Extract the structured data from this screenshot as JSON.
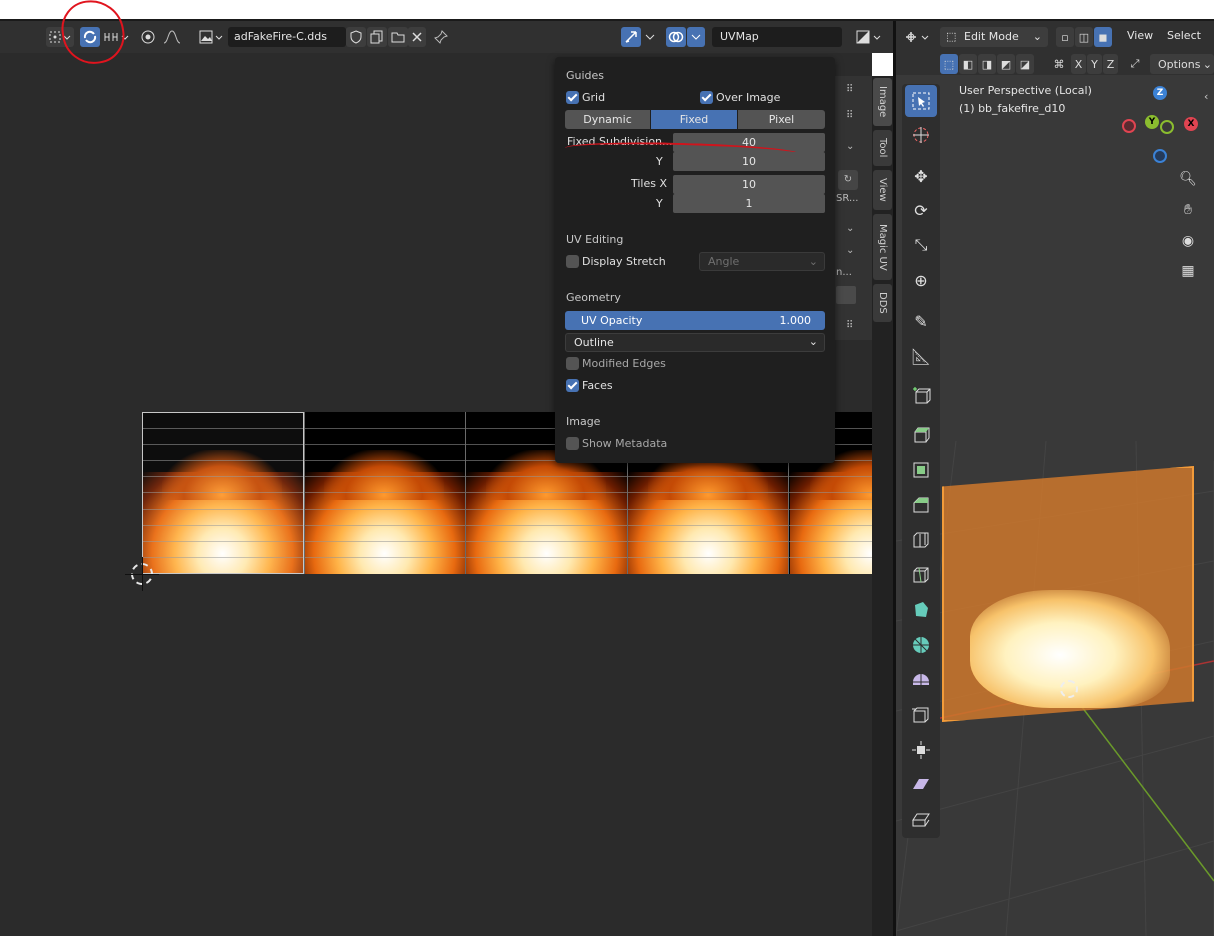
{
  "uv_editor": {
    "image_name": "adFakeFire-C.dds",
    "uv_map": "UVMap",
    "sidebar_tabs": [
      "Image",
      "Tool",
      "View",
      "Magic UV",
      "DDS"
    ],
    "panel_fragments": [
      "SR...",
      "n..."
    ]
  },
  "overlay_popover": {
    "guides_title": "Guides",
    "grid_label": "Grid",
    "grid_checked": true,
    "over_image_label": "Over Image",
    "over_image_checked": true,
    "grid_modes": [
      "Dynamic",
      "Fixed",
      "Pixel"
    ],
    "grid_mode_selected": "Fixed",
    "fixed_subdivisions_label": "Fixed Subdivision...",
    "fixed_subdivisions_x": "40",
    "y_label": "Y",
    "fixed_subdivisions_y": "10",
    "tiles_x_label": "Tiles X",
    "tiles_x": "10",
    "tiles_y_label": "Y",
    "tiles_y": "1",
    "uv_editing_title": "UV Editing",
    "display_stretch_label": "Display Stretch",
    "display_stretch_checked": false,
    "stretch_type": "Angle",
    "geometry_title": "Geometry",
    "uv_opacity_label": "UV Opacity",
    "uv_opacity_value": "1.000",
    "edge_display": "Outline",
    "modified_edges_label": "Modified Edges",
    "modified_edges_checked": false,
    "faces_label": "Faces",
    "faces_checked": true,
    "image_title": "Image",
    "show_metadata_label": "Show Metadata",
    "show_metadata_checked": false
  },
  "viewport": {
    "mode": "Edit Mode",
    "menu": [
      "View",
      "Select"
    ],
    "axis_buttons": [
      "X",
      "Y",
      "Z"
    ],
    "options_label": "Options",
    "perspective_label": "User Perspective (Local)",
    "object_label": "(1) bb_fakefire_d10",
    "gizmo_axes": [
      "Z",
      "Y",
      "X"
    ]
  },
  "colors": {
    "accent": "#4772b3",
    "annotation_red": "#d0141c",
    "axis_x": "#e04451",
    "axis_y": "#8bbd2f",
    "axis_z": "#3b82d6"
  }
}
